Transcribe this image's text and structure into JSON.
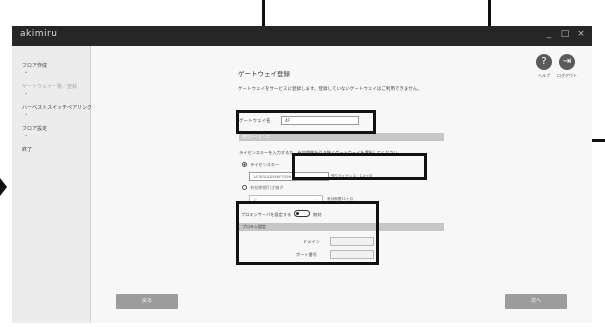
{
  "app": {
    "title": "akimiru"
  },
  "window": {
    "minimize": "_",
    "maximize": "□",
    "close": "×"
  },
  "sidebar": {
    "items": [
      {
        "label": "フロア作成"
      },
      {
        "label": "ゲートウェイ一覧／登録"
      },
      {
        "label": "ハーベストスイッチペアリング"
      },
      {
        "label": "フロア設定"
      },
      {
        "label": "終了"
      }
    ]
  },
  "header": {
    "help_label": "ヘルプ",
    "logout_label": "ログアウト"
  },
  "page": {
    "title": "ゲートウェイ登録",
    "description": "ゲートウェイをサービスに登録します。登録していないゲートウェイはご利用できません。"
  },
  "gateway": {
    "name_label": "ゲートウェイ名",
    "name_value": "4F"
  },
  "license": {
    "section_label": "使用ライセンス",
    "instruction": "ライセンスキーを入力するか、有効期間を引き継ぐゲートウェイを選択してください。",
    "key_option_label": "ライセンスキー",
    "key_value": "1A7B3C4D5E6F7G8H",
    "key_note": "残りライセンス：1.0ヶ月",
    "inherit_option_label": "有効期間引き継ぎ",
    "inherit_select_value": "1F",
    "inherit_note": "有効期間12ヶ月"
  },
  "proxy": {
    "toggle_label": "プロキシサーバを設定する",
    "toggle_state": "無効",
    "section_label": "プロキシ設定",
    "domain_label": "ドメイン",
    "port_label": "ポート番号"
  },
  "footer": {
    "back_label": "戻る",
    "next_label": "次へ"
  }
}
